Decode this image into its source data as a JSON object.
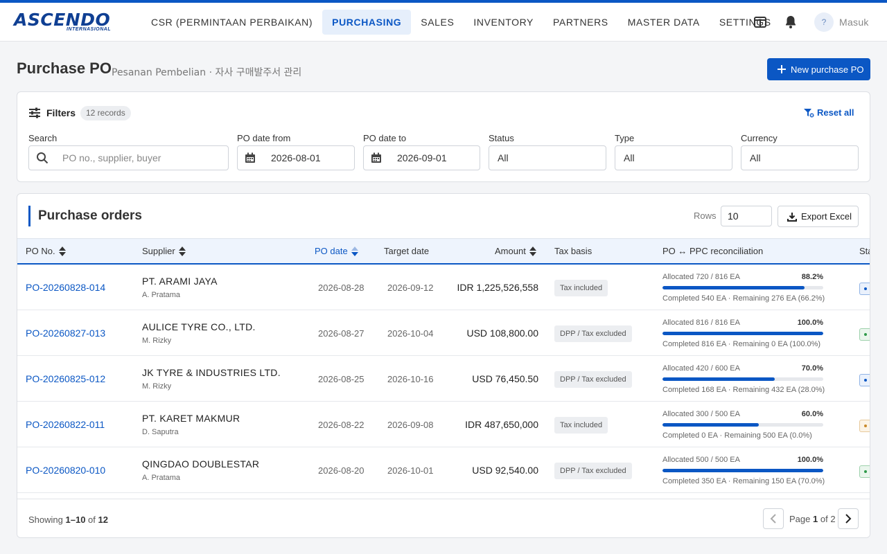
{
  "app": {
    "logo_text": "ASCENDO",
    "logo_sub": "INTERNASIONAL",
    "nav": [
      {
        "label": "CSR (PERMINTAAN PERBAIKAN)",
        "active": false
      },
      {
        "label": "PURCHASING",
        "active": true
      },
      {
        "label": "SALES",
        "active": false
      },
      {
        "label": "INVENTORY",
        "active": false
      },
      {
        "label": "PARTNERS",
        "active": false
      },
      {
        "label": "MASTER DATA",
        "active": false
      },
      {
        "label": "SETTINGS",
        "active": false
      }
    ],
    "avatar_initial": "?",
    "login_label": "Masuk",
    "icons": [
      "layout-icon",
      "bell-icon"
    ],
    "accent_color": "#0b57c4"
  },
  "page": {
    "title": "Purchase PO",
    "subtitle": "Pesanan Pembelian · 자사 구매발주서 관리",
    "new_button": "New purchase PO"
  },
  "filters": {
    "title": "Filters",
    "records_badge": "12 records",
    "reset_label": "Reset all",
    "search": {
      "label": "Search",
      "placeholder": "PO no., supplier, buyer",
      "value": ""
    },
    "date_from": {
      "label": "PO date from",
      "value": "2026-08-01"
    },
    "date_to": {
      "label": "PO date to",
      "value": "2026-09-01"
    },
    "status": {
      "label": "Status",
      "value": "All"
    },
    "type": {
      "label": "Type",
      "value": "All"
    },
    "currency": {
      "label": "Currency",
      "value": "All"
    }
  },
  "orders": {
    "title": "Purchase orders",
    "rows_label": "Rows",
    "rows_value": "10",
    "export_label": "Export Excel",
    "columns": {
      "po_no": "PO No.",
      "supplier": "Supplier",
      "po_date": "PO date",
      "target_date": "Target date",
      "amount": "Amount",
      "tax_basis": "Tax basis",
      "reconciliation": "PO ↔ PPC reconciliation",
      "status": "Sta"
    },
    "rows": [
      {
        "po_no": "PO-20260828-014",
        "supplier": "PT. ARAMI JAYA",
        "buyer": "A. Pratama",
        "po_date": "2026-08-28",
        "target_date": "2026-09-12",
        "amount": "IDR 1,225,526,558",
        "tax": "Tax included",
        "alloc": "Allocated 720 / 816 EA",
        "pct": "88.2%",
        "fill": 0.882,
        "completed": "Completed 540 EA · Remaining 276 EA (66.2%)",
        "status_color": "#0b57c4",
        "status_bg": "#eaf1fc"
      },
      {
        "po_no": "PO-20260827-013",
        "supplier": "AULICE TYRE CO., LTD.",
        "buyer": "M. Rizky",
        "po_date": "2026-08-27",
        "target_date": "2026-10-04",
        "amount": "USD 108,800.00",
        "tax": "DPP / Tax excluded",
        "alloc": "Allocated 816 / 816 EA",
        "pct": "100.0%",
        "fill": 1.0,
        "completed": "Completed 816 EA · Remaining 0 EA (100.0%)",
        "status_color": "#2e9a4a",
        "status_bg": "#eaf6ed"
      },
      {
        "po_no": "PO-20260825-012",
        "supplier": "JK TYRE & INDUSTRIES LTD.",
        "buyer": "M. Rizky",
        "po_date": "2026-08-25",
        "target_date": "2026-10-16",
        "amount": "USD 76,450.50",
        "tax": "DPP / Tax excluded",
        "alloc": "Allocated 420 / 600 EA",
        "pct": "70.0%",
        "fill": 0.7,
        "completed": "Completed 168 EA · Remaining 432 EA (28.0%)",
        "status_color": "#0b57c4",
        "status_bg": "#eaf1fc"
      },
      {
        "po_no": "PO-20260822-011",
        "supplier": "PT. KARET MAKMUR",
        "buyer": "D. Saputra",
        "po_date": "2026-08-22",
        "target_date": "2026-09-08",
        "amount": "IDR 487,650,000",
        "tax": "Tax included",
        "alloc": "Allocated 300 / 500 EA",
        "pct": "60.0%",
        "fill": 0.6,
        "completed": "Completed 0 EA · Remaining 500 EA (0.0%)",
        "status_color": "#c98a2a",
        "status_bg": "#fcf4e6"
      },
      {
        "po_no": "PO-20260820-010",
        "supplier": "QINGDAO DOUBLESTAR",
        "buyer": "A. Pratama",
        "po_date": "2026-08-20",
        "target_date": "2026-10-01",
        "amount": "USD 92,540.00",
        "tax": "DPP / Tax excluded",
        "alloc": "Allocated 500 / 500 EA",
        "pct": "100.0%",
        "fill": 1.0,
        "completed": "Completed 350 EA · Remaining 150 EA (70.0%)",
        "status_color": "#2e9a4a",
        "status_bg": "#eaf6ed"
      }
    ]
  },
  "pagination": {
    "showing_prefix": "Showing",
    "showing_range": "1–10",
    "showing_of": "of",
    "showing_total": "12",
    "page_prefix": "Page",
    "page_current": "1",
    "page_of": "of",
    "page_total": "2"
  }
}
